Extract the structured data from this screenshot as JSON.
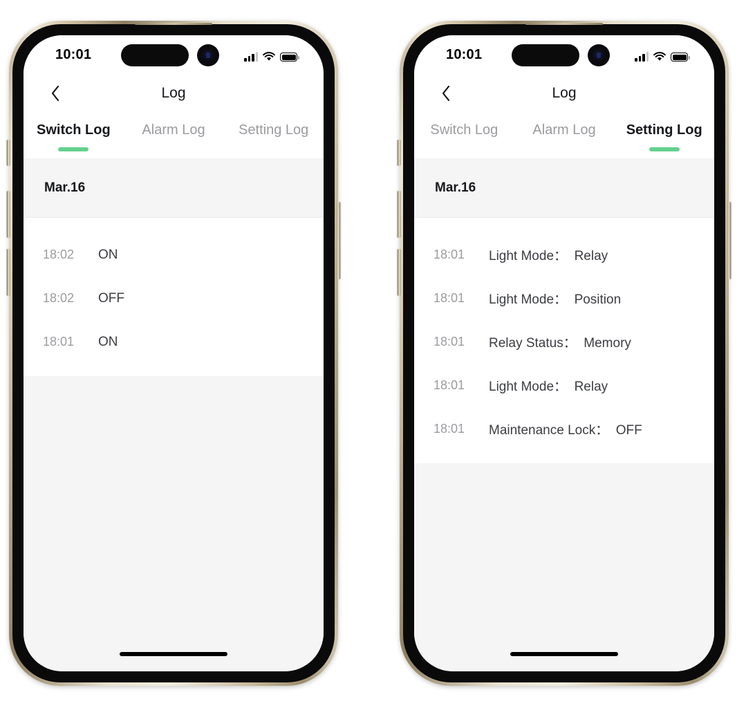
{
  "phones": [
    {
      "id": "switch-log-phone",
      "status_bar": {
        "time": "10:01",
        "signal_icon": "cellular-signal-icon",
        "wifi_icon": "wifi-icon",
        "battery_icon": "battery-full-icon"
      },
      "nav": {
        "back_icon": "chevron-left-icon",
        "title": "Log"
      },
      "tabs": [
        {
          "label": "Switch Log",
          "active": true
        },
        {
          "label": "Alarm Log",
          "active": false
        },
        {
          "label": "Setting Log",
          "active": false
        }
      ],
      "log": {
        "date": "Mar.16",
        "entries": [
          {
            "time": "18:02",
            "text": "ON"
          },
          {
            "time": "18:02",
            "text": "OFF"
          },
          {
            "time": "18:01",
            "text": "ON"
          }
        ]
      }
    },
    {
      "id": "setting-log-phone",
      "status_bar": {
        "time": "10:01",
        "signal_icon": "cellular-signal-icon",
        "wifi_icon": "wifi-icon",
        "battery_icon": "battery-full-icon"
      },
      "nav": {
        "back_icon": "chevron-left-icon",
        "title": "Log"
      },
      "tabs": [
        {
          "label": "Switch Log",
          "active": false
        },
        {
          "label": "Alarm Log",
          "active": false
        },
        {
          "label": "Setting Log",
          "active": true
        }
      ],
      "log": {
        "date": "Mar.16",
        "entries": [
          {
            "time": "18:01",
            "text": "Light Mode：  Relay"
          },
          {
            "time": "18:01",
            "text": "Light Mode：  Position"
          },
          {
            "time": "18:01",
            "text": "Relay Status：  Memory"
          },
          {
            "time": "18:01",
            "text": "Light Mode：  Relay"
          },
          {
            "time": "18:01",
            "text": "Maintenance Lock：  OFF"
          }
        ]
      }
    }
  ],
  "colors": {
    "accent_green": "#63d18c",
    "active_text": "#17181c",
    "inactive_text": "#9b9b9f",
    "time_text": "#9c9ca0",
    "entry_text": "#3c3d41",
    "screen_bg": "#f5f5f5",
    "panel_bg": "#ffffff",
    "frame_gold": "#cdbfa0",
    "bezel_black": "#0a0a0a"
  }
}
